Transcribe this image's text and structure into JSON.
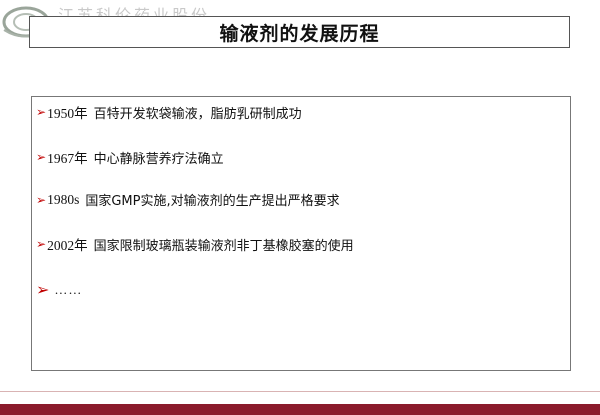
{
  "header": {
    "faint_text": "江苏科伦药业股份…",
    "title": "输液剂的发展历程"
  },
  "items": [
    {
      "year": "1950年",
      "text": "百特开发软袋输液，脂肪乳研制成功"
    },
    {
      "year": "1967年",
      "text": "中心静脉营养疗法确立"
    },
    {
      "year": "1980s",
      "text": "国家GMP实施,对输液剂的生产提出严格要求"
    },
    {
      "year": "2002年",
      "text": "国家限制玻璃瓶装输液剂非丁基橡胶塞的使用"
    }
  ],
  "ellipsis": "……",
  "colors": {
    "arrow": "#c00000",
    "bottom_bar": "#8b1a2b"
  },
  "icons": {
    "bullet": "arrow-bullet-icon",
    "logo": "logo-icon"
  }
}
